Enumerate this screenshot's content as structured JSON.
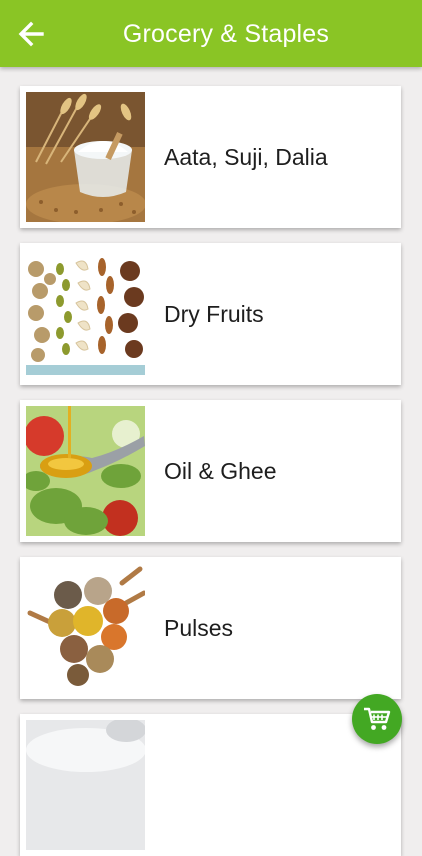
{
  "header": {
    "title": "Grocery & Staples",
    "back_icon": "arrow-left-icon",
    "background_color": "#8ac525"
  },
  "categories": [
    {
      "label": "Aata, Suji, Dalia",
      "image": "flour-wheat-image"
    },
    {
      "label": "Dry Fruits",
      "image": "dry-fruits-image"
    },
    {
      "label": "Oil & Ghee",
      "image": "oil-spoon-image"
    },
    {
      "label": "Pulses",
      "image": "pulses-spoons-image"
    },
    {
      "label": "",
      "image": "sugar-salt-image"
    }
  ],
  "cart_button": {
    "icon": "shopping-cart-icon",
    "color": "#43a823"
  }
}
